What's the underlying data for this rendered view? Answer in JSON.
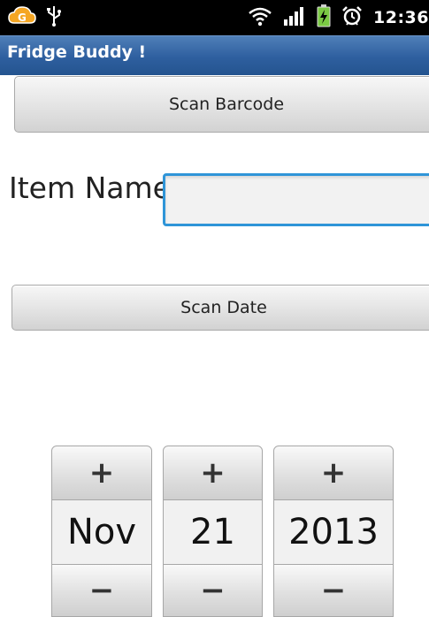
{
  "status_bar": {
    "time": "12:36",
    "icons": [
      "g-cloud-icon",
      "usb-icon",
      "wifi-icon",
      "signal-icon",
      "battery-charging-icon",
      "alarm-icon"
    ]
  },
  "app": {
    "title": "Fridge Buddy !"
  },
  "form": {
    "scan_barcode_label": "Scan Barcode",
    "item_name_label": "Item Name",
    "item_name_value": "",
    "scan_date_label": "Scan Date"
  },
  "date_picker": {
    "increment_symbol": "+",
    "decrement_symbol": "−",
    "month": "Nov",
    "day": "21",
    "year": "2013"
  },
  "colors": {
    "title_bar": "#2e5f9f",
    "input_focus": "#2f95d8",
    "battery": "#7ac943",
    "cloud_icon": "#f5a623"
  }
}
